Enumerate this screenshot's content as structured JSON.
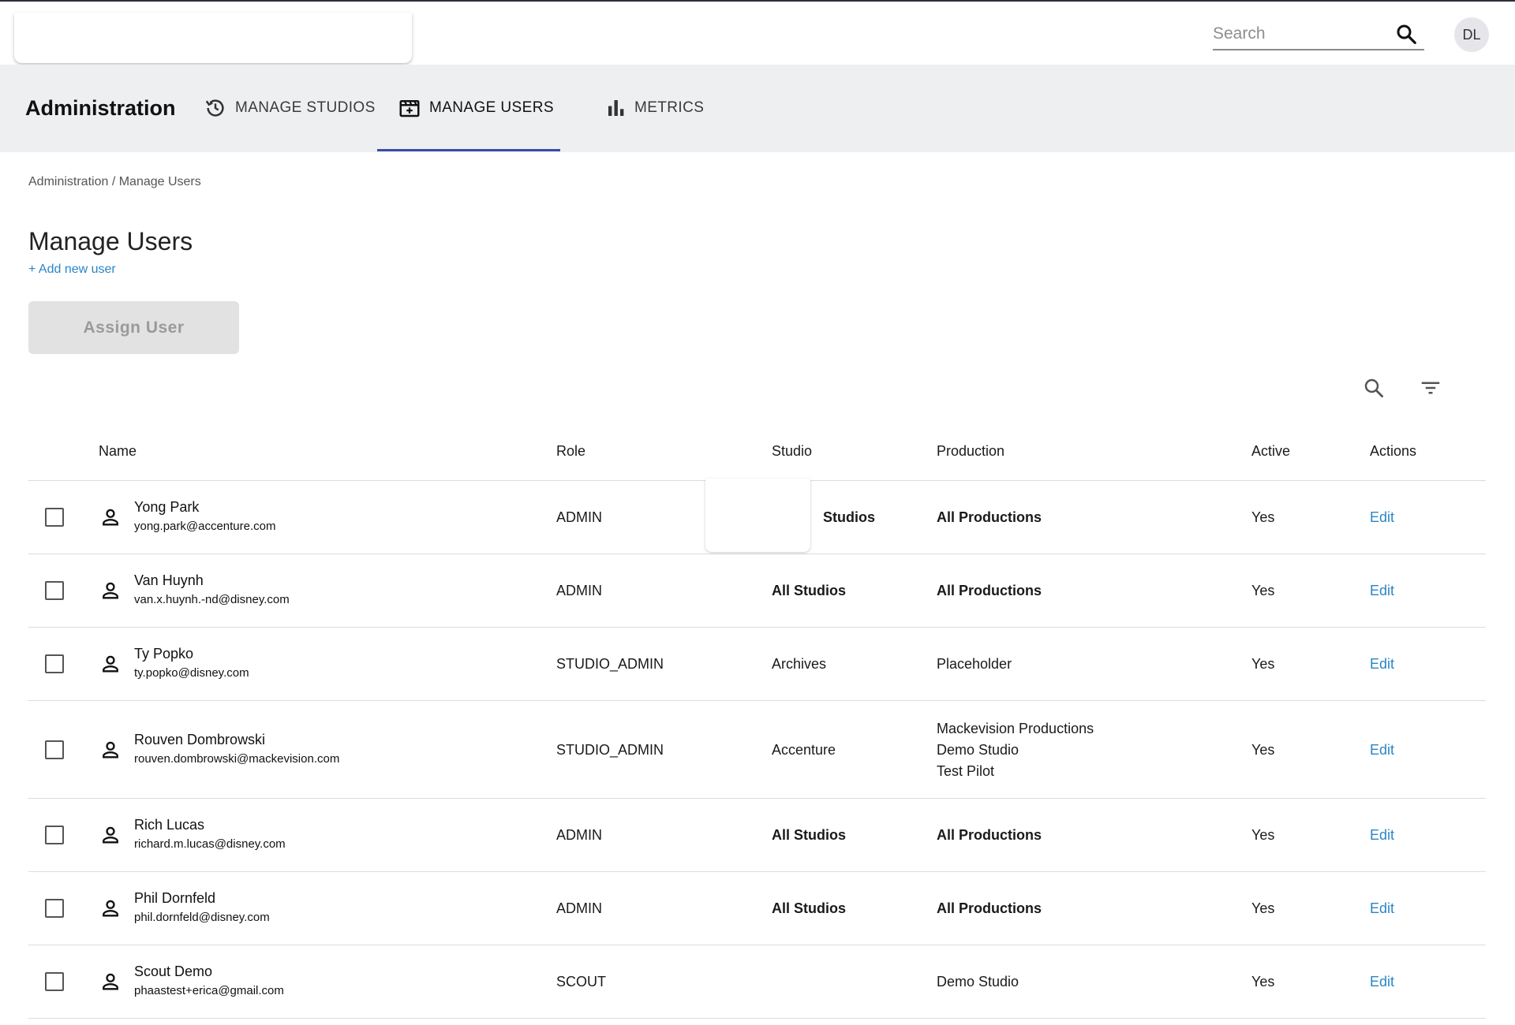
{
  "header": {
    "search": {
      "placeholder": "Search",
      "value": ""
    },
    "avatar_initials": "DL"
  },
  "admin_nav": {
    "title": "Administration",
    "tabs": [
      {
        "label": "MANAGE STUDIOS",
        "icon": "history-icon",
        "active": false
      },
      {
        "label": "MANAGE USERS",
        "icon": "movie-edit-icon",
        "active": true
      },
      {
        "label": "METRICS",
        "icon": "bar-chart-icon",
        "active": false
      }
    ],
    "accent_color": "#3a4ba8"
  },
  "breadcrumb": "Administration / Manage Users",
  "page_title": "Manage Users",
  "add_user_label": "+ Add new user",
  "assign_button_label": "Assign User",
  "table": {
    "columns": [
      "Name",
      "Role",
      "Studio",
      "Production",
      "Active",
      "Actions"
    ],
    "rows": [
      {
        "name": "Yong Park",
        "email": "yong.park@accenture.com",
        "role": "ADMIN",
        "studio": "Studios",
        "studio_bold": true,
        "production": [
          "All Productions"
        ],
        "production_bold": true,
        "active": "Yes",
        "action": "Edit"
      },
      {
        "name": "Van Huynh",
        "email": "van.x.huynh.-nd@disney.com",
        "role": "ADMIN",
        "studio": "All Studios",
        "studio_bold": true,
        "production": [
          "All Productions"
        ],
        "production_bold": true,
        "active": "Yes",
        "action": "Edit"
      },
      {
        "name": "Ty Popko",
        "email": "ty.popko@disney.com",
        "role": "STUDIO_ADMIN",
        "studio": "Archives",
        "studio_bold": false,
        "production": [
          "Placeholder"
        ],
        "production_bold": false,
        "active": "Yes",
        "action": "Edit"
      },
      {
        "name": "Rouven Dombrowski",
        "email": "rouven.dombrowski@mackevision.com",
        "role": "STUDIO_ADMIN",
        "studio": "Accenture",
        "studio_bold": false,
        "production": [
          "Mackevision Productions",
          "Demo Studio",
          "Test Pilot"
        ],
        "production_bold": false,
        "active": "Yes",
        "action": "Edit"
      },
      {
        "name": "Rich Lucas",
        "email": "richard.m.lucas@disney.com",
        "role": "ADMIN",
        "studio": "All Studios",
        "studio_bold": true,
        "production": [
          "All Productions"
        ],
        "production_bold": true,
        "active": "Yes",
        "action": "Edit"
      },
      {
        "name": "Phil Dornfeld",
        "email": "phil.dornfeld@disney.com",
        "role": "ADMIN",
        "studio": "All Studios",
        "studio_bold": true,
        "production": [
          "All Productions"
        ],
        "production_bold": true,
        "active": "Yes",
        "action": "Edit"
      },
      {
        "name": "Scout Demo",
        "email": "phaastest+erica@gmail.com",
        "role": "SCOUT",
        "studio": "",
        "studio_bold": false,
        "production": [
          "Demo Studio"
        ],
        "production_bold": false,
        "active": "Yes",
        "action": "Edit"
      }
    ]
  }
}
